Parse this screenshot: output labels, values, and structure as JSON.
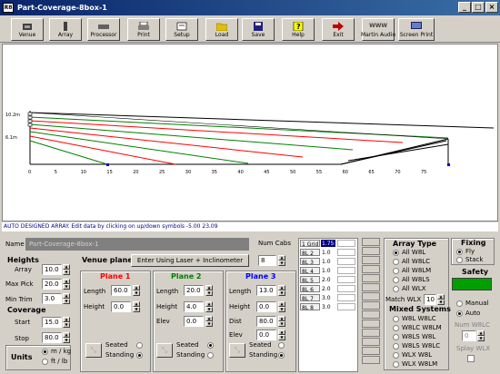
{
  "window": {
    "title": "Part-Coverage-8box-1",
    "app_icon": "R8"
  },
  "toolbar": [
    {
      "name": "venue",
      "label": "Venue",
      "icon": "venue-icon"
    },
    {
      "name": "array",
      "label": "Array",
      "icon": "array-icon"
    },
    {
      "name": "processor",
      "label": "Processor",
      "icon": "processor-icon"
    },
    {
      "name": "print",
      "label": "Print",
      "icon": "print-icon"
    },
    {
      "name": "setup",
      "label": "Setup",
      "icon": "setup-icon"
    },
    {
      "name": "load",
      "label": "Load",
      "icon": "load-icon"
    },
    {
      "name": "save",
      "label": "Save",
      "icon": "save-icon"
    },
    {
      "name": "help",
      "label": "Help",
      "icon": "help-icon"
    },
    {
      "name": "exit",
      "label": "Exit",
      "icon": "exit-icon"
    },
    {
      "name": "martin-audio",
      "label": "Martin Audio",
      "icon": "martin-audio-logo"
    },
    {
      "name": "screen-print",
      "label": "Screen Print",
      "icon": "screen-print-icon"
    }
  ],
  "plot": {
    "y_labels": [
      "10.2m",
      "6.1m"
    ],
    "x_ticks": [
      "0",
      "5",
      "10",
      "15",
      "20",
      "25",
      "30",
      "35",
      "40",
      "45",
      "50",
      "55",
      "60",
      "65",
      "70",
      "75"
    ]
  },
  "status": {
    "text": "AUTO DESIGNED ARRAY.  Edit data by clicking on up/down symbols   -5.00  23.09"
  },
  "name": {
    "label": "Name",
    "value": "Part-Coverage-8box-1"
  },
  "num_cabs": {
    "label": "Num Cabs",
    "value": "8"
  },
  "heights": {
    "title": "Heights",
    "array_label": "Array",
    "array_value": "10.0",
    "maxpick_label": "Max Pick",
    "maxpick_value": "20.0",
    "mintrim_label": "Min Trim",
    "mintrim_value": "3.0"
  },
  "coverage": {
    "title": "Coverage",
    "start_label": "Start",
    "start_value": "15.0",
    "stop_label": "Stop",
    "stop_value": "80.0"
  },
  "units": {
    "title": "Units",
    "opt1": "m / kg",
    "opt2": "ft / lb"
  },
  "venue_planes": {
    "title": "Venue planes",
    "laser_button": "Enter Using Laser + Inclinometer"
  },
  "plane1": {
    "title": "Plane 1",
    "title_color": "#ff0000",
    "length_label": "Length",
    "length_value": "60.0",
    "height_label": "Height",
    "height_value": "0.0",
    "seated_label": "Seated",
    "standing_label": "Standing"
  },
  "plane2": {
    "title": "Plane 2",
    "title_color": "#008000",
    "length_label": "Length",
    "length_value": "20.0",
    "height_label": "Height",
    "height_value": "4.0",
    "elev_label": "Elev",
    "elev_value": "0.0",
    "seated_label": "Seated",
    "standing_label": "Standing"
  },
  "plane3": {
    "title": "Plane 3",
    "title_color": "#0000ff",
    "length_label": "Length",
    "length_value": "13.0",
    "height_label": "Height",
    "height_value": "0.0",
    "dist_label": "Dist",
    "dist_value": "80.0",
    "elev_label": "Elev",
    "elev_value": "0.0",
    "seated_label": "Seated",
    "standing_label": "Standing"
  },
  "grid_table": [
    {
      "c1": "1 Grid",
      "c2": "1.75"
    },
    {
      "c1": "8L 2",
      "c2": "1.0"
    },
    {
      "c1": "8L 3",
      "c2": "1.0"
    },
    {
      "c1": "8L 4",
      "c2": "1.0"
    },
    {
      "c1": "8L 5",
      "c2": "2.0"
    },
    {
      "c1": "8L 6",
      "c2": "2.0"
    },
    {
      "c1": "8L 7",
      "c2": "3.0"
    },
    {
      "c1": "8L 8",
      "c2": "3.0"
    }
  ],
  "array_type": {
    "title": "Array Type",
    "options": [
      "All W8L",
      "All W8LC",
      "All W8LM",
      "All W8LS",
      "All WLX"
    ],
    "match_label": "Match WLX",
    "match_value": "10"
  },
  "mixed_systems": {
    "title": "Mixed Systems",
    "options": [
      "W8L W8LC",
      "W8LC W8LM",
      "W8LS W8L",
      "W8LS W8LC",
      "WLX W8L",
      "WLX W8LM"
    ]
  },
  "fixing": {
    "title": "Fixing",
    "fly": "Fly",
    "stack": "Stack"
  },
  "safety": {
    "title": "Safety",
    "color": "#00a000"
  },
  "mode": {
    "manual": "Manual",
    "auto": "Auto",
    "num_label": "Num W8LC",
    "num_value": "0",
    "splay_label": "Splay WLX"
  }
}
